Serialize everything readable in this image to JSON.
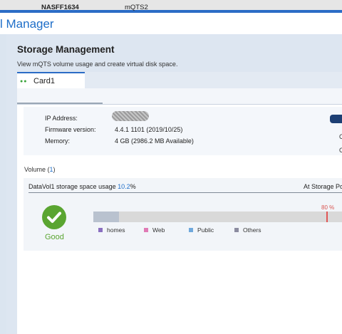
{
  "window": {
    "title": "l Manager"
  },
  "header": {
    "title": "Storage Management",
    "description": "View mQTS volume usage and create virtual disk space."
  },
  "card_tab": {
    "label": "Card1",
    "status": "●●"
  },
  "subtabs": [
    {
      "label": "NASFF1634",
      "active": true
    },
    {
      "label": "mQTS2",
      "active": false
    }
  ],
  "device_info": {
    "ip_label": "IP Address:",
    "firmware_label": "Firmware version:",
    "firmware_value": "4.4.1 1101 (2019/10/25)",
    "memory_label": "Memory:",
    "memory_value": "4 GB (2986.2 MB Available)"
  },
  "action_menu": {
    "item1": "C",
    "item2": "C"
  },
  "volume": {
    "label_prefix": "Volume (",
    "count": "1",
    "label_suffix": ")",
    "name_prefix": "DataVol1 storage space usage ",
    "usage_percent": "10.2",
    "usage_suffix": "%",
    "usage_fraction": 0.102,
    "location": "At Storage Poo",
    "status": "Good",
    "threshold_label": "80 %",
    "threshold_fraction": 0.8
  },
  "legend": [
    {
      "label": "homes",
      "color": "#8a6fc0"
    },
    {
      "label": "Web",
      "color": "#e07ab5"
    },
    {
      "label": "Public",
      "color": "#6fa8dc"
    },
    {
      "label": "Others",
      "color": "#8c8ca0"
    }
  ],
  "icons": {
    "status": "check-circle-icon"
  },
  "colors": {
    "accent": "#2b6cc6",
    "good": "#5aa531",
    "threshold": "#e05555"
  }
}
